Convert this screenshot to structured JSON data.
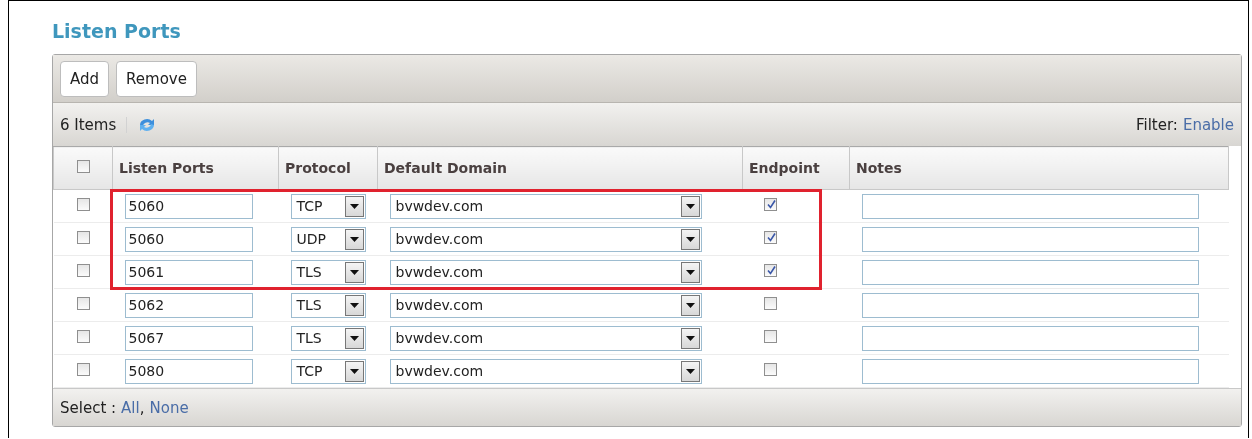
{
  "title": "Listen Ports",
  "toolbar": {
    "buttons": [
      "Add",
      "Remove"
    ]
  },
  "info": {
    "count": "6 Items",
    "filter_label": "Filter:",
    "filter_link": "Enable"
  },
  "table": {
    "header_checked": false,
    "columns": [
      "Listen Ports",
      "Protocol",
      "Default Domain",
      "Endpoint",
      "Notes"
    ],
    "rows": [
      {
        "checked": false,
        "port": "5060",
        "protocol": "TCP",
        "domain": "bvwdev.com",
        "endpoint": true,
        "highlighted": true
      },
      {
        "checked": false,
        "port": "5060",
        "protocol": "UDP",
        "domain": "bvwdev.com",
        "endpoint": true,
        "highlighted": true
      },
      {
        "checked": false,
        "port": "5061",
        "protocol": "TLS",
        "domain": "bvwdev.com",
        "endpoint": true,
        "highlighted": true
      },
      {
        "checked": false,
        "port": "5062",
        "protocol": "TLS",
        "domain": "bvwdev.com",
        "endpoint": false,
        "highlighted": false
      },
      {
        "checked": false,
        "port": "5067",
        "protocol": "TLS",
        "domain": "bvwdev.com",
        "endpoint": false,
        "highlighted": false
      },
      {
        "checked": false,
        "port": "5080",
        "protocol": "TCP",
        "domain": "bvwdev.com",
        "endpoint": false,
        "highlighted": false
      }
    ]
  },
  "footer": {
    "label": "Select :",
    "links": [
      "All",
      "None"
    ],
    "separator": ","
  }
}
